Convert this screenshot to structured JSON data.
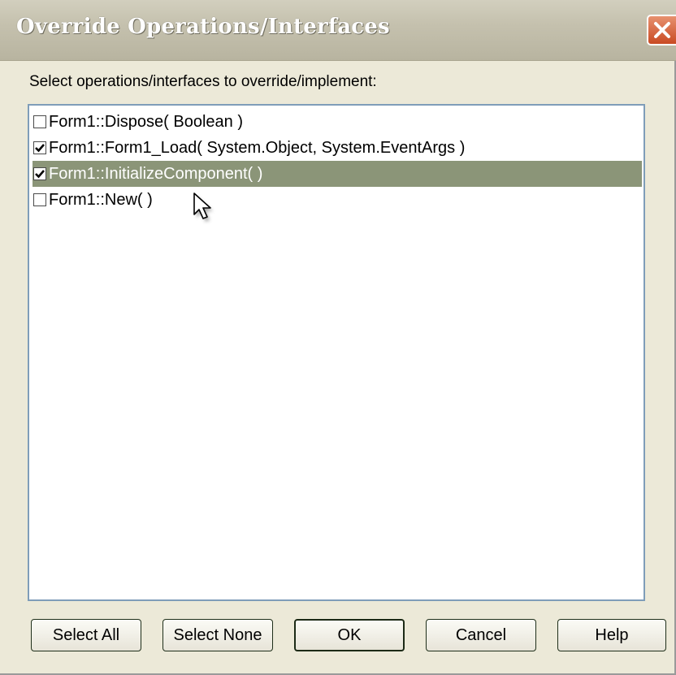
{
  "window": {
    "title": "Override Operations/Interfaces"
  },
  "prompt": "Select operations/interfaces to override/implement:",
  "items": [
    {
      "label": "Form1::Dispose( Boolean )",
      "checked": false,
      "selected": false
    },
    {
      "label": "Form1::Form1_Load( System.Object, System.EventArgs )",
      "checked": true,
      "selected": false
    },
    {
      "label": "Form1::InitializeComponent(  )",
      "checked": true,
      "selected": true
    },
    {
      "label": "Form1::New(  )",
      "checked": false,
      "selected": false
    }
  ],
  "buttons": {
    "select_all": "Select All",
    "select_none": "Select None",
    "ok": "OK",
    "cancel": "Cancel",
    "help": "Help"
  },
  "colors": {
    "dialog_bg": "#ece9d8",
    "selection_bg": "#8b9578",
    "close_button": "#c94a23",
    "list_border": "#7f9db9"
  },
  "icons": {
    "close": "close-icon",
    "check": "check-icon",
    "cursor": "mouse-pointer-icon"
  }
}
